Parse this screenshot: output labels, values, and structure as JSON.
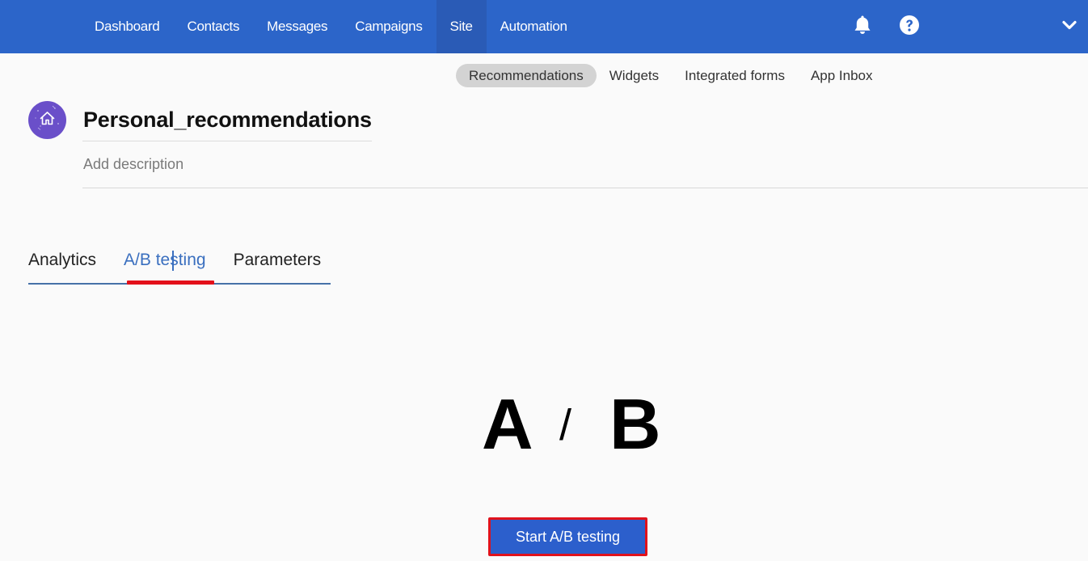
{
  "topnav": {
    "items": [
      {
        "label": "Dashboard",
        "active": false
      },
      {
        "label": "Contacts",
        "active": false
      },
      {
        "label": "Messages",
        "active": false
      },
      {
        "label": "Campaigns",
        "active": false
      },
      {
        "label": "Site",
        "active": true
      },
      {
        "label": "Automation",
        "active": false
      }
    ],
    "icons": {
      "notifications": "bell-icon",
      "help": "help-icon",
      "account_menu": "chevron-down-icon"
    },
    "background_color": "#2c65c9"
  },
  "subnav": {
    "items": [
      {
        "label": "Recommendations",
        "active": true
      },
      {
        "label": "Widgets",
        "active": false
      },
      {
        "label": "Integrated forms",
        "active": false
      },
      {
        "label": "App Inbox",
        "active": false
      }
    ]
  },
  "header": {
    "avatar_icon": "home-icon",
    "avatar_color": "#6a4fc9",
    "title": "Personal_recommendations",
    "description_placeholder": "Add description"
  },
  "tabs": {
    "items": [
      {
        "label": "Analytics",
        "active": false
      },
      {
        "label": "A/B testing",
        "active": true
      },
      {
        "label": "Parameters",
        "active": false
      }
    ],
    "active_color": "#3a6fbf",
    "highlight_color": "#e3101a"
  },
  "ab_illustration": {
    "left": "A",
    "separator": "/",
    "right": "B"
  },
  "start_button": {
    "label": "Start A/B testing",
    "color": "#2c5fcc",
    "highlight_color": "#e0121c"
  }
}
